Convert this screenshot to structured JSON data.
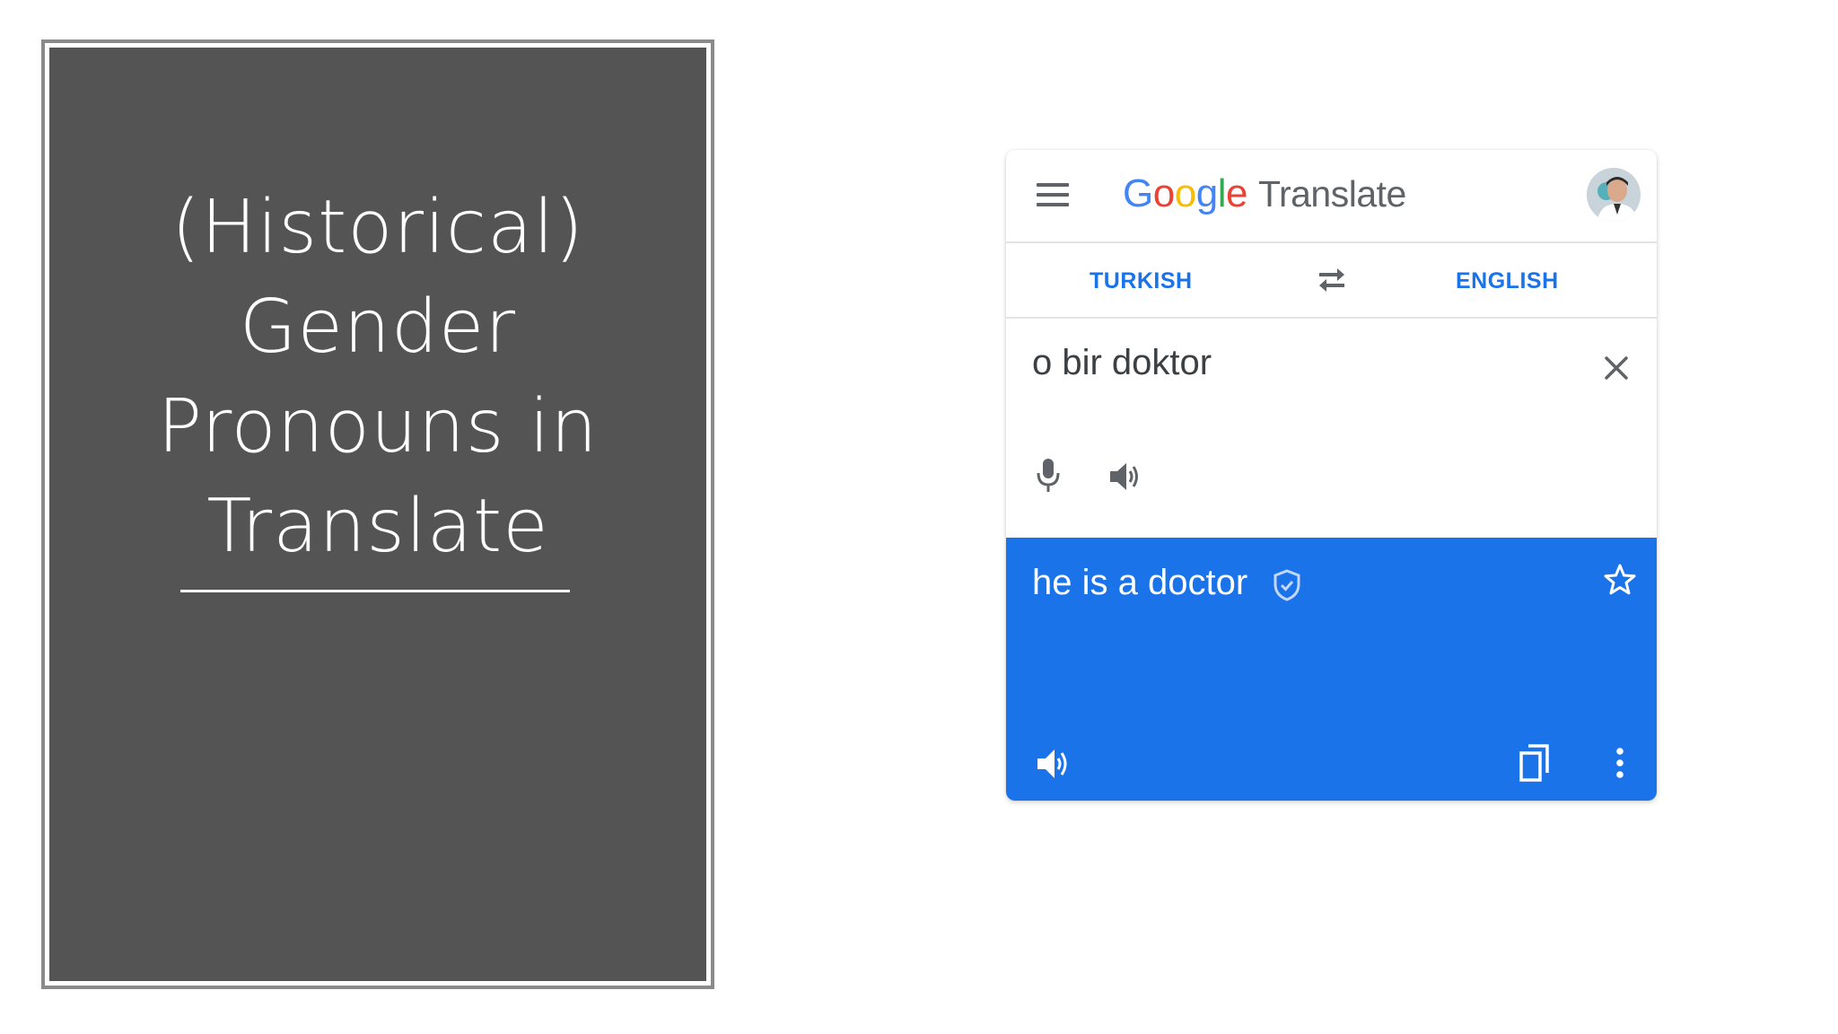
{
  "slide": {
    "title_lines": [
      "(Historical)",
      "Gender",
      "Pronouns in",
      "Translate"
    ]
  },
  "translate_app": {
    "logo_text": "Google",
    "product_name": "Translate",
    "source_language": "TURKISH",
    "target_language": "ENGLISH",
    "source_text": "o bir doktor",
    "translated_text": "he is a doctor",
    "icons": {
      "menu": "menu-icon",
      "avatar": "avatar",
      "swap": "swap-languages-icon",
      "clear": "close-icon",
      "mic": "microphone-icon",
      "source_speaker": "speaker-icon",
      "verified": "verified-shield-icon",
      "star": "star-icon",
      "target_speaker": "speaker-icon",
      "copy": "copy-icon",
      "more": "more-vert-icon"
    },
    "colors": {
      "accent_blue": "#1a73e8",
      "title_panel": "#545454",
      "icon_gray": "#5f6368"
    }
  }
}
